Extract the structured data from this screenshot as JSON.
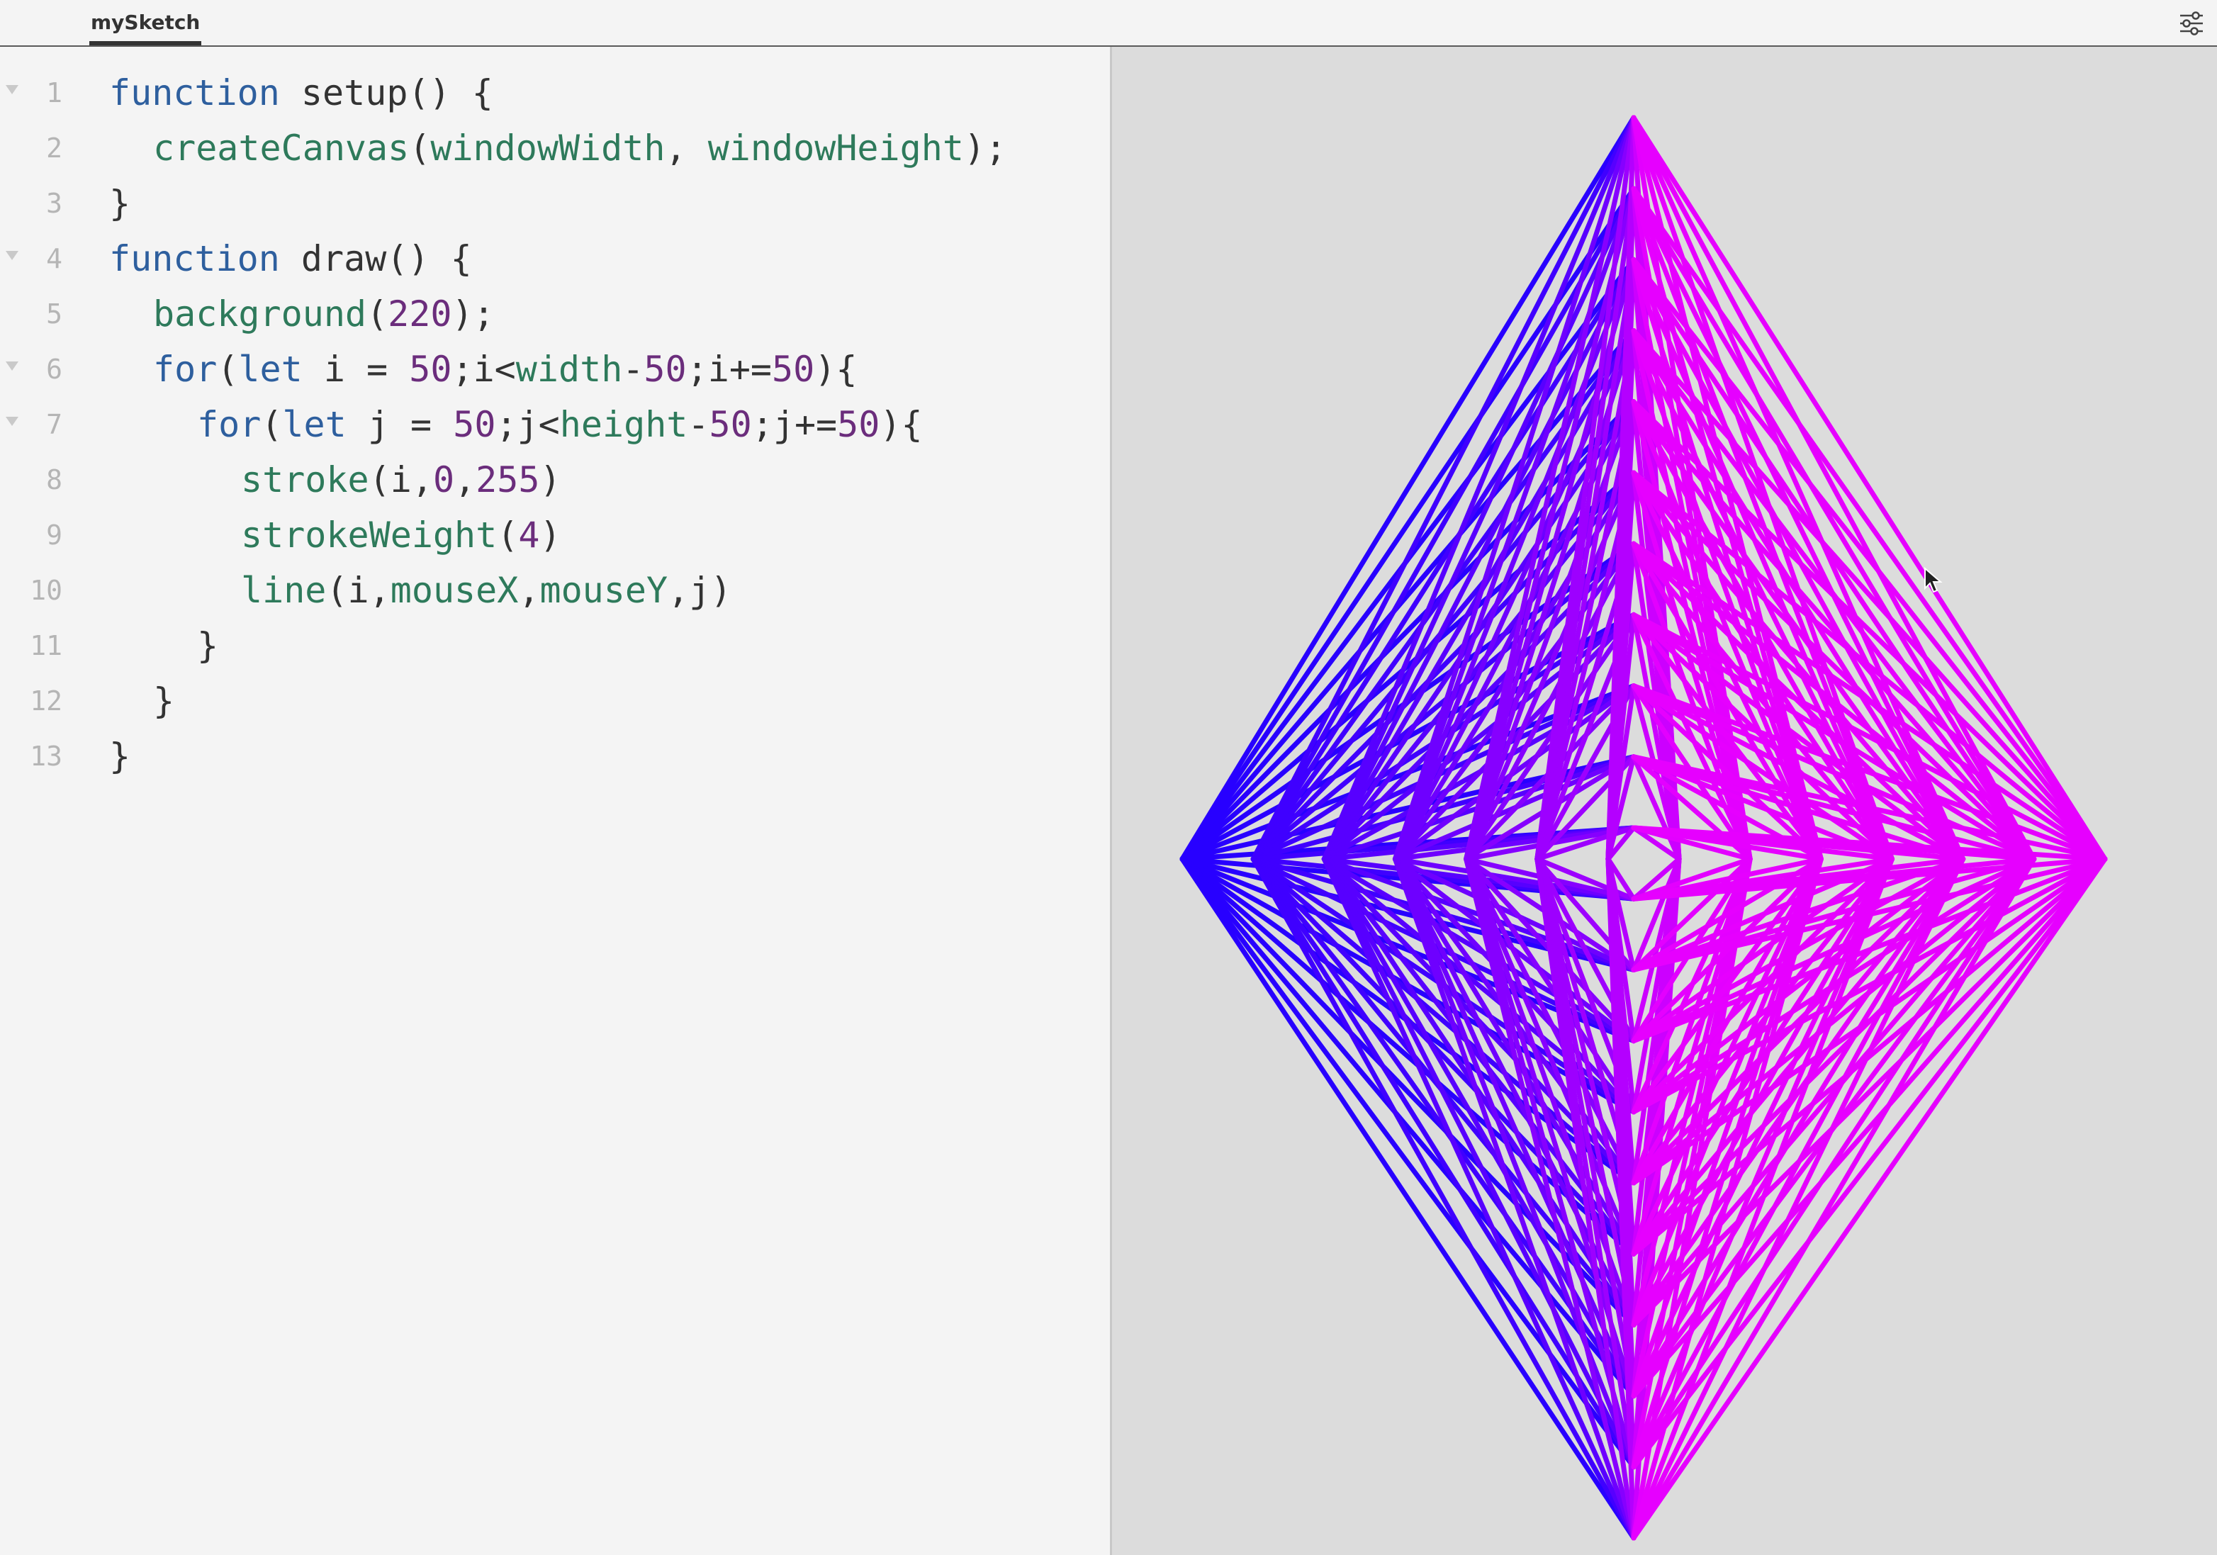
{
  "tab": {
    "label": "mySketch"
  },
  "editor": {
    "lines": [
      {
        "num": "1",
        "fold": true,
        "indent": 0,
        "tokens": [
          [
            "kw",
            "function"
          ],
          [
            "op",
            " setup() {"
          ]
        ]
      },
      {
        "num": "2",
        "fold": false,
        "indent": 1,
        "tokens": [
          [
            "fn",
            "createCanvas"
          ],
          [
            "op",
            "("
          ],
          [
            "fn",
            "windowWidth"
          ],
          [
            "op",
            ", "
          ],
          [
            "fn",
            "windowHeight"
          ],
          [
            "op",
            ");"
          ]
        ]
      },
      {
        "num": "3",
        "fold": false,
        "indent": 0,
        "tokens": [
          [
            "op",
            "}"
          ]
        ]
      },
      {
        "num": "4",
        "fold": true,
        "indent": 0,
        "tokens": [
          [
            "kw",
            "function"
          ],
          [
            "op",
            " draw() {"
          ]
        ]
      },
      {
        "num": "5",
        "fold": false,
        "indent": 1,
        "tokens": [
          [
            "fn",
            "background"
          ],
          [
            "op",
            "("
          ],
          [
            "num",
            "220"
          ],
          [
            "op",
            ");"
          ]
        ]
      },
      {
        "num": "6",
        "fold": true,
        "indent": 1,
        "tokens": [
          [
            "kw",
            "for"
          ],
          [
            "op",
            "("
          ],
          [
            "kw",
            "let"
          ],
          [
            "op",
            " i = "
          ],
          [
            "num",
            "50"
          ],
          [
            "op",
            ";i<"
          ],
          [
            "fn",
            "width"
          ],
          [
            "op",
            "-"
          ],
          [
            "num",
            "50"
          ],
          [
            "op",
            ";i+="
          ],
          [
            "num",
            "50"
          ],
          [
            "op",
            "){"
          ]
        ]
      },
      {
        "num": "7",
        "fold": true,
        "indent": 2,
        "tokens": [
          [
            "kw",
            "for"
          ],
          [
            "op",
            "("
          ],
          [
            "kw",
            "let"
          ],
          [
            "op",
            " j = "
          ],
          [
            "num",
            "50"
          ],
          [
            "op",
            ";j<"
          ],
          [
            "fn",
            "height"
          ],
          [
            "op",
            "-"
          ],
          [
            "num",
            "50"
          ],
          [
            "op",
            ";j+="
          ],
          [
            "num",
            "50"
          ],
          [
            "op",
            "){"
          ]
        ]
      },
      {
        "num": "8",
        "fold": false,
        "indent": 3,
        "tokens": [
          [
            "fn",
            "stroke"
          ],
          [
            "op",
            "(i,"
          ],
          [
            "num",
            "0"
          ],
          [
            "op",
            ","
          ],
          [
            "num",
            "255"
          ],
          [
            "op",
            ")"
          ]
        ]
      },
      {
        "num": "9",
        "fold": false,
        "indent": 3,
        "tokens": [
          [
            "fn",
            "strokeWeight"
          ],
          [
            "op",
            "("
          ],
          [
            "num",
            "4"
          ],
          [
            "op",
            ")"
          ]
        ]
      },
      {
        "num": "10",
        "fold": false,
        "indent": 3,
        "tokens": [
          [
            "fn",
            "line"
          ],
          [
            "op",
            "(i,"
          ],
          [
            "fn",
            "mouseX"
          ],
          [
            "op",
            ","
          ],
          [
            "fn",
            "mouseY"
          ],
          [
            "op",
            ",j)"
          ]
        ]
      },
      {
        "num": "11",
        "fold": false,
        "indent": 2,
        "tokens": [
          [
            "op",
            "}"
          ]
        ]
      },
      {
        "num": "12",
        "fold": false,
        "indent": 1,
        "tokens": [
          [
            "op",
            "}"
          ]
        ]
      },
      {
        "num": "13",
        "fold": false,
        "indent": 0,
        "tokens": [
          [
            "op",
            "}"
          ]
        ]
      }
    ]
  },
  "icons": {
    "settings": "sliders-icon",
    "cursor": "mouse-pointer-icon"
  },
  "colors": {
    "keyword": "#2e5f9e",
    "function": "#2e7a5b",
    "number": "#6b2d7c",
    "canvas_bg": "#dcdcdc"
  }
}
